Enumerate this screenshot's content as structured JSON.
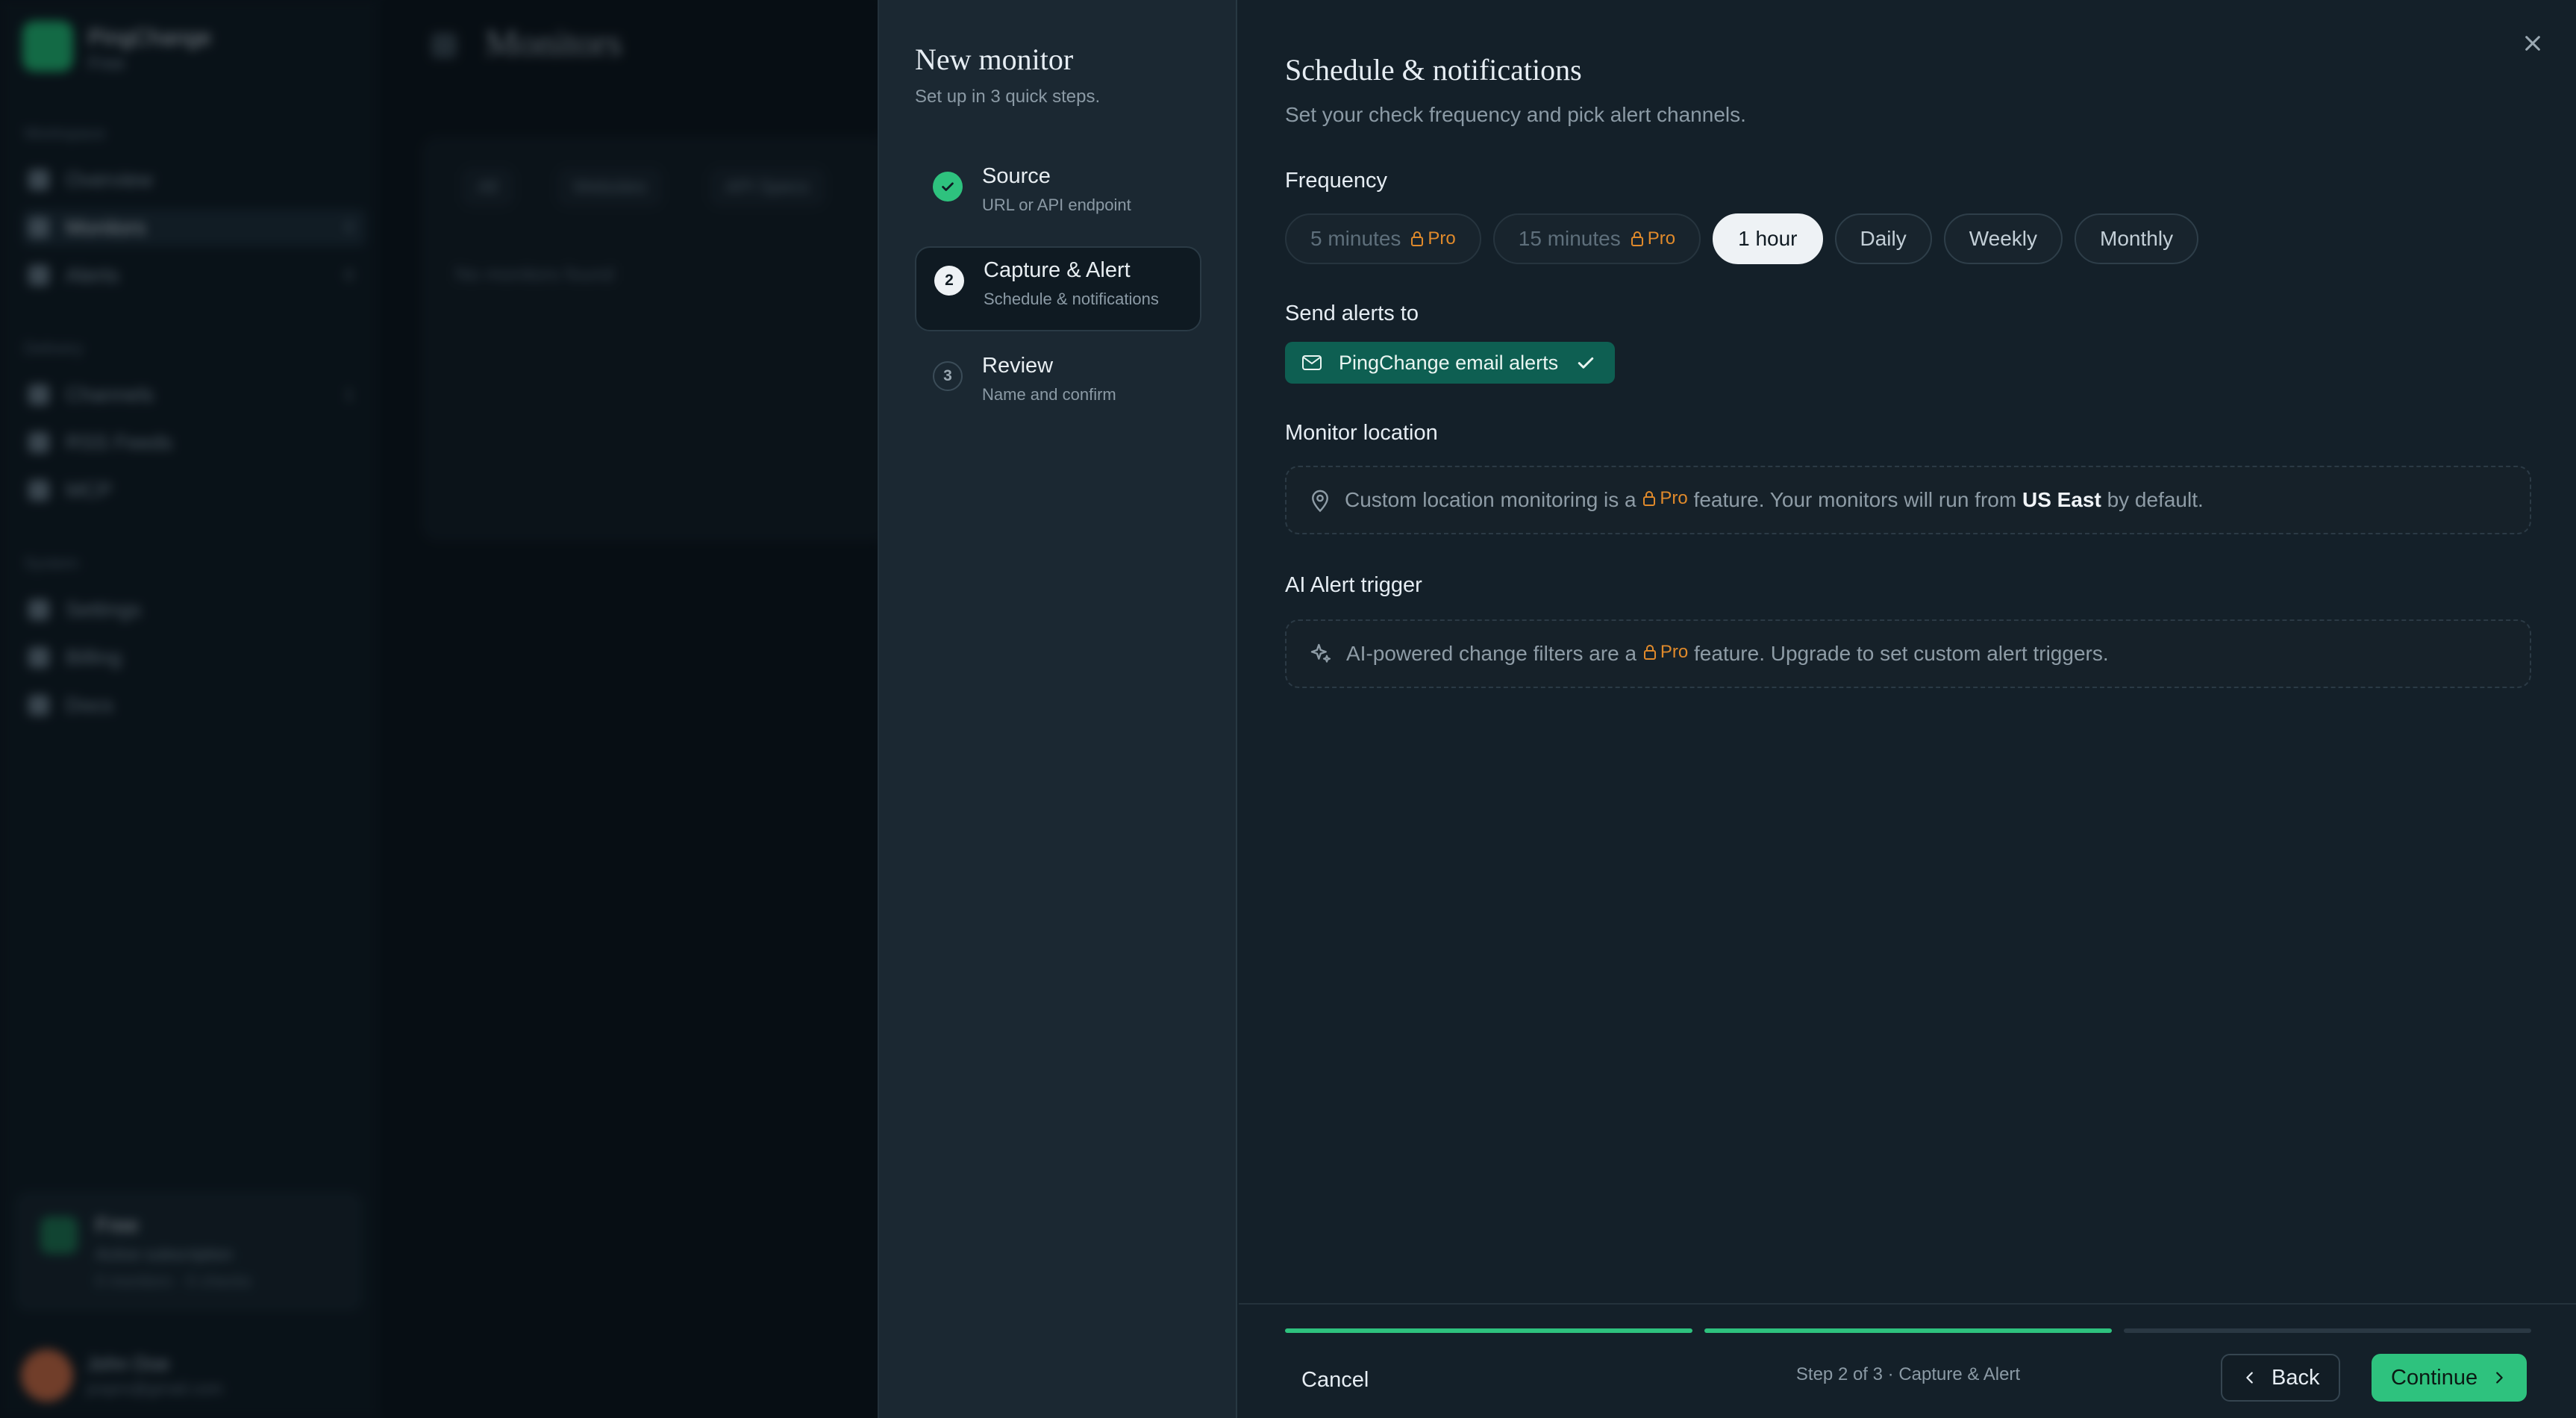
{
  "background": {
    "brand_name": "PingChange",
    "brand_plan": "Free",
    "sections": {
      "workspace": "Workspace",
      "delivery": "Delivery",
      "system": "System"
    },
    "nav": [
      {
        "label": "Overview",
        "count": ""
      },
      {
        "label": "Monitors",
        "count": "0"
      },
      {
        "label": "Alerts",
        "count": "0"
      },
      {
        "label": "Channels",
        "count": "1"
      },
      {
        "label": "RSS Feeds",
        "count": ""
      },
      {
        "label": "MCP",
        "count": ""
      },
      {
        "label": "Settings",
        "count": ""
      },
      {
        "label": "Billing",
        "count": ""
      },
      {
        "label": "Docs",
        "count": ""
      }
    ],
    "plan_card": {
      "title": "Free",
      "subtitle": "Active subscription",
      "meta": "0 monitors · 0 checks"
    },
    "user": {
      "name": "John Doe",
      "email": "jospro@gmail.com"
    },
    "page_title": "Monitors",
    "filters": [
      "All",
      "Websites",
      "API Specs"
    ],
    "empty_text": "No monitors found"
  },
  "modal": {
    "title": "New monitor",
    "subtitle": "Set up in 3 quick steps.",
    "steps": [
      {
        "number": "1",
        "title": "Source",
        "subtitle": "URL or API endpoint",
        "state": "done"
      },
      {
        "number": "2",
        "title": "Capture & Alert",
        "subtitle": "Schedule & notifications",
        "state": "current"
      },
      {
        "number": "3",
        "title": "Review",
        "subtitle": "Name and confirm",
        "state": "todo"
      }
    ],
    "content": {
      "title": "Schedule & notifications",
      "subtitle": "Set your check frequency and pick alert channels.",
      "frequency": {
        "label": "Frequency",
        "options": [
          {
            "label": "5 minutes",
            "badge": "Pro",
            "locked": true
          },
          {
            "label": "15 minutes",
            "badge": "Pro",
            "locked": true
          },
          {
            "label": "1 hour",
            "badge": "",
            "selected": true
          },
          {
            "label": "Daily",
            "badge": ""
          },
          {
            "label": "Weekly",
            "badge": ""
          },
          {
            "label": "Monthly",
            "badge": ""
          }
        ],
        "selected": "1 hour"
      },
      "alerts": {
        "label": "Send alerts to",
        "channel": "PingChange email alerts"
      },
      "location": {
        "label": "Monitor location",
        "text_before": "Custom location monitoring is a",
        "badge": "Pro",
        "text_middle": "feature. Your monitors will run from",
        "region": "US East",
        "text_after": "by default."
      },
      "ai_trigger": {
        "label": "AI Alert trigger",
        "text_before": "AI-powered change filters are a",
        "badge": "Pro",
        "text_after": "feature. Upgrade to set custom alert triggers."
      }
    },
    "footer": {
      "cancel": "Cancel",
      "step_info": "Step 2 of 3 · Capture & Alert",
      "back": "Back",
      "continue": "Continue",
      "progress_completed_steps": 2,
      "progress_total_steps": 3
    }
  },
  "colors": {
    "accent": "#2ec27e",
    "pro_badge": "#e08a2b",
    "alert_chip": "#0e5f52"
  }
}
